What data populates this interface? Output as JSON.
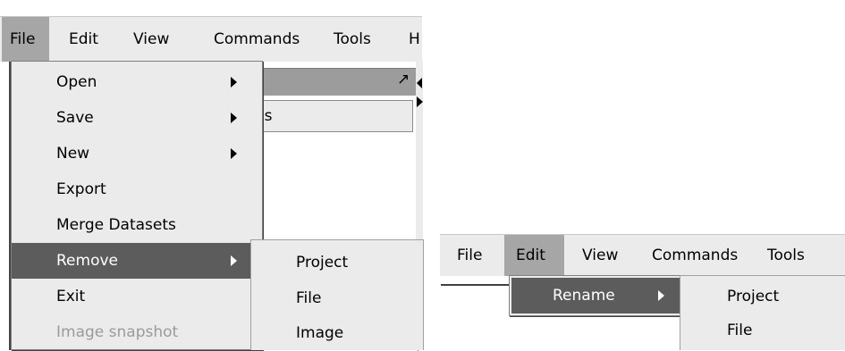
{
  "left": {
    "menubar": [
      {
        "label": "File"
      },
      {
        "label": "Edit"
      },
      {
        "label": "View"
      },
      {
        "label": "Commands"
      },
      {
        "label": "Tools"
      },
      {
        "label": "H"
      }
    ],
    "file_menu": [
      {
        "label": "Open"
      },
      {
        "label": "Save"
      },
      {
        "label": "New"
      },
      {
        "label": "Export"
      },
      {
        "label": "Merge Datasets"
      },
      {
        "label": "Remove"
      },
      {
        "label": "Exit"
      },
      {
        "label": "Image snapshot"
      }
    ],
    "remove_submenu": [
      {
        "label": "Project"
      },
      {
        "label": "File"
      },
      {
        "label": "Image"
      }
    ],
    "background_panel": {
      "tab_fragment": "'s",
      "expand_glyph": "↗"
    }
  },
  "right": {
    "menubar": [
      {
        "label": "File"
      },
      {
        "label": "Edit"
      },
      {
        "label": "View"
      },
      {
        "label": "Commands"
      },
      {
        "label": "Tools"
      }
    ],
    "edit_menu": [
      {
        "label": "Rename"
      }
    ],
    "rename_submenu": [
      {
        "label": "Project"
      },
      {
        "label": "File"
      }
    ]
  },
  "colors": {
    "menu_bg": "#ebebeb",
    "open_menu_bg": "#a6a6a6",
    "highlight_bg": "#5c5c5c",
    "disabled_text": "#9a9a9a"
  }
}
